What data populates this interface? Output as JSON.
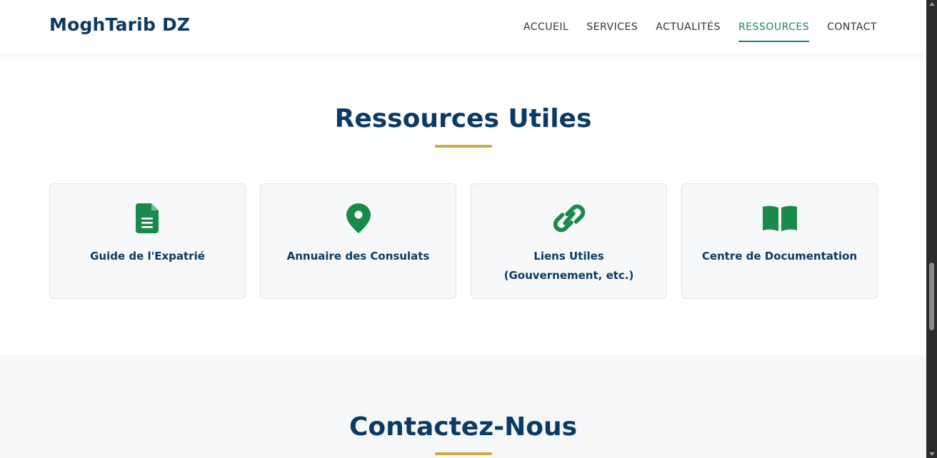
{
  "header": {
    "logo": "MoghTarib DZ",
    "nav": [
      {
        "label": "ACCUEIL",
        "active": false
      },
      {
        "label": "SERVICES",
        "active": false
      },
      {
        "label": "ACTUALITÉS",
        "active": false
      },
      {
        "label": "RESSOURCES",
        "active": true
      },
      {
        "label": "CONTACT",
        "active": false
      }
    ]
  },
  "resources": {
    "title": "Ressources Utiles",
    "cards": [
      {
        "icon": "document-icon",
        "label": "Guide de l'Expatrié"
      },
      {
        "icon": "map-pin-icon",
        "label": "Annuaire des Consulats"
      },
      {
        "icon": "link-icon",
        "label": "Liens Utiles (Gouvernement, etc.)"
      },
      {
        "icon": "book-icon",
        "label": "Centre de Documentation"
      }
    ]
  },
  "contact": {
    "title": "Contactez-Nous"
  },
  "colors": {
    "navy": "#0b3a66",
    "green": "#1a8a4a",
    "gold": "#c9ac46",
    "card_bg": "#f6f8fa",
    "section_bg": "#f5f7f9"
  }
}
